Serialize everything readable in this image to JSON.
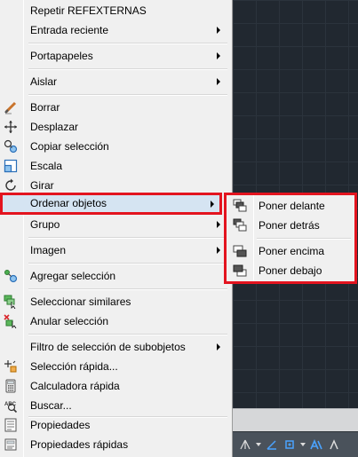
{
  "menu": {
    "items": [
      {
        "label": "Repetir REFEXTERNAS",
        "icon": "",
        "submenu": false
      },
      {
        "label": "Entrada reciente",
        "icon": "",
        "submenu": true
      },
      {
        "label": "Portapapeles",
        "icon": "",
        "submenu": true
      },
      {
        "label": "Aislar",
        "icon": "",
        "submenu": true
      },
      {
        "label": "Borrar",
        "icon": "eraser-icon",
        "submenu": false
      },
      {
        "label": "Desplazar",
        "icon": "move-icon",
        "submenu": false
      },
      {
        "label": "Copiar selección",
        "icon": "copy-selection-icon",
        "submenu": false
      },
      {
        "label": "Escala",
        "icon": "scale-icon",
        "submenu": false
      },
      {
        "label": "Girar",
        "icon": "rotate-icon",
        "submenu": false
      },
      {
        "label": "Ordenar objetos",
        "icon": "",
        "submenu": true,
        "highlighted": true
      },
      {
        "label": "Grupo",
        "icon": "",
        "submenu": true
      },
      {
        "label": "Imagen",
        "icon": "",
        "submenu": true
      },
      {
        "label": "Agregar selección",
        "icon": "add-selected-icon",
        "submenu": false
      },
      {
        "label": "Seleccionar similares",
        "icon": "select-similar-icon",
        "submenu": false
      },
      {
        "label": "Anular selección",
        "icon": "deselect-all-icon",
        "submenu": false
      },
      {
        "label": "Filtro de selección de subobjetos",
        "icon": "",
        "submenu": true
      },
      {
        "label": "Selección rápida...",
        "icon": "quick-select-icon",
        "submenu": false
      },
      {
        "label": "Calculadora rápida",
        "icon": "calculator-icon",
        "submenu": false
      },
      {
        "label": "Buscar...",
        "icon": "find-icon",
        "submenu": false
      },
      {
        "label": "Propiedades",
        "icon": "properties-icon",
        "submenu": false
      },
      {
        "label": "Propiedades rápidas",
        "icon": "quick-properties-icon",
        "submenu": false
      }
    ]
  },
  "submenu": {
    "items": [
      {
        "label": "Poner delante",
        "icon": "bring-to-front-icon"
      },
      {
        "label": "Poner detrás",
        "icon": "send-to-back-icon"
      },
      {
        "label": "Poner encima",
        "icon": "bring-above-icon"
      },
      {
        "label": "Poner debajo",
        "icon": "send-under-icon"
      }
    ]
  },
  "colors": {
    "menu_bg": "#f0f0f0",
    "highlight_bg": "#d5e4f2",
    "annotation_red": "#e3141f",
    "canvas_bg": "#212830"
  }
}
